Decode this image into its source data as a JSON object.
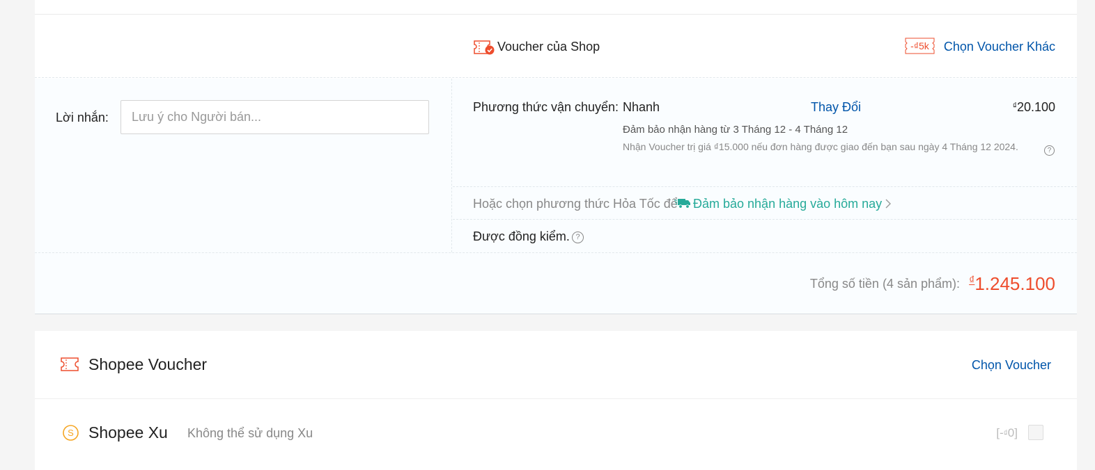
{
  "shop_voucher": {
    "label": "Voucher của Shop",
    "tag": "-₫5k",
    "choose_other": "Chọn Voucher Khác",
    "icon": "shop-voucher-ticket-icon"
  },
  "message": {
    "label": "Lời nhắn:",
    "placeholder": "Lưu ý cho Người bán...",
    "value": ""
  },
  "shipping": {
    "label": "Phương thức vận chuyển:",
    "method": "Nhanh",
    "change": "Thay Đổi",
    "currency": "₫",
    "price": "20.100",
    "guarantee": "Đảm bảo nhận hàng từ 3 Tháng 12 - 4 Tháng 12",
    "voucher_note": "Nhận Voucher trị giá ₫15.000 nếu đơn hàng được giao đến bạn sau ngày 4 Tháng 12 2024."
  },
  "express": {
    "text": "Hoặc chọn phương thức Hỏa Tốc để",
    "guarantee": "Đảm bảo nhận hàng vào hôm nay",
    "icon": "express-truck-icon"
  },
  "cod_check": {
    "text": "Được đồng kiểm."
  },
  "total": {
    "label": "Tổng số tiền (4 sản phẩm):",
    "currency": "₫",
    "value": "1.245.100"
  },
  "shopee_voucher": {
    "label": "Shopee Voucher",
    "choose": "Chọn Voucher"
  },
  "shopee_xu": {
    "label": "Shopee Xu",
    "note": "Không thể sử dụng Xu",
    "amount_prefix": "[-",
    "currency": "₫",
    "amount": "0",
    "amount_suffix": "]",
    "checked": false
  },
  "colors": {
    "accent": "#ee4d2d",
    "link": "#0055aa",
    "teal": "#26aa99",
    "xu_gold": "#f5a623"
  }
}
